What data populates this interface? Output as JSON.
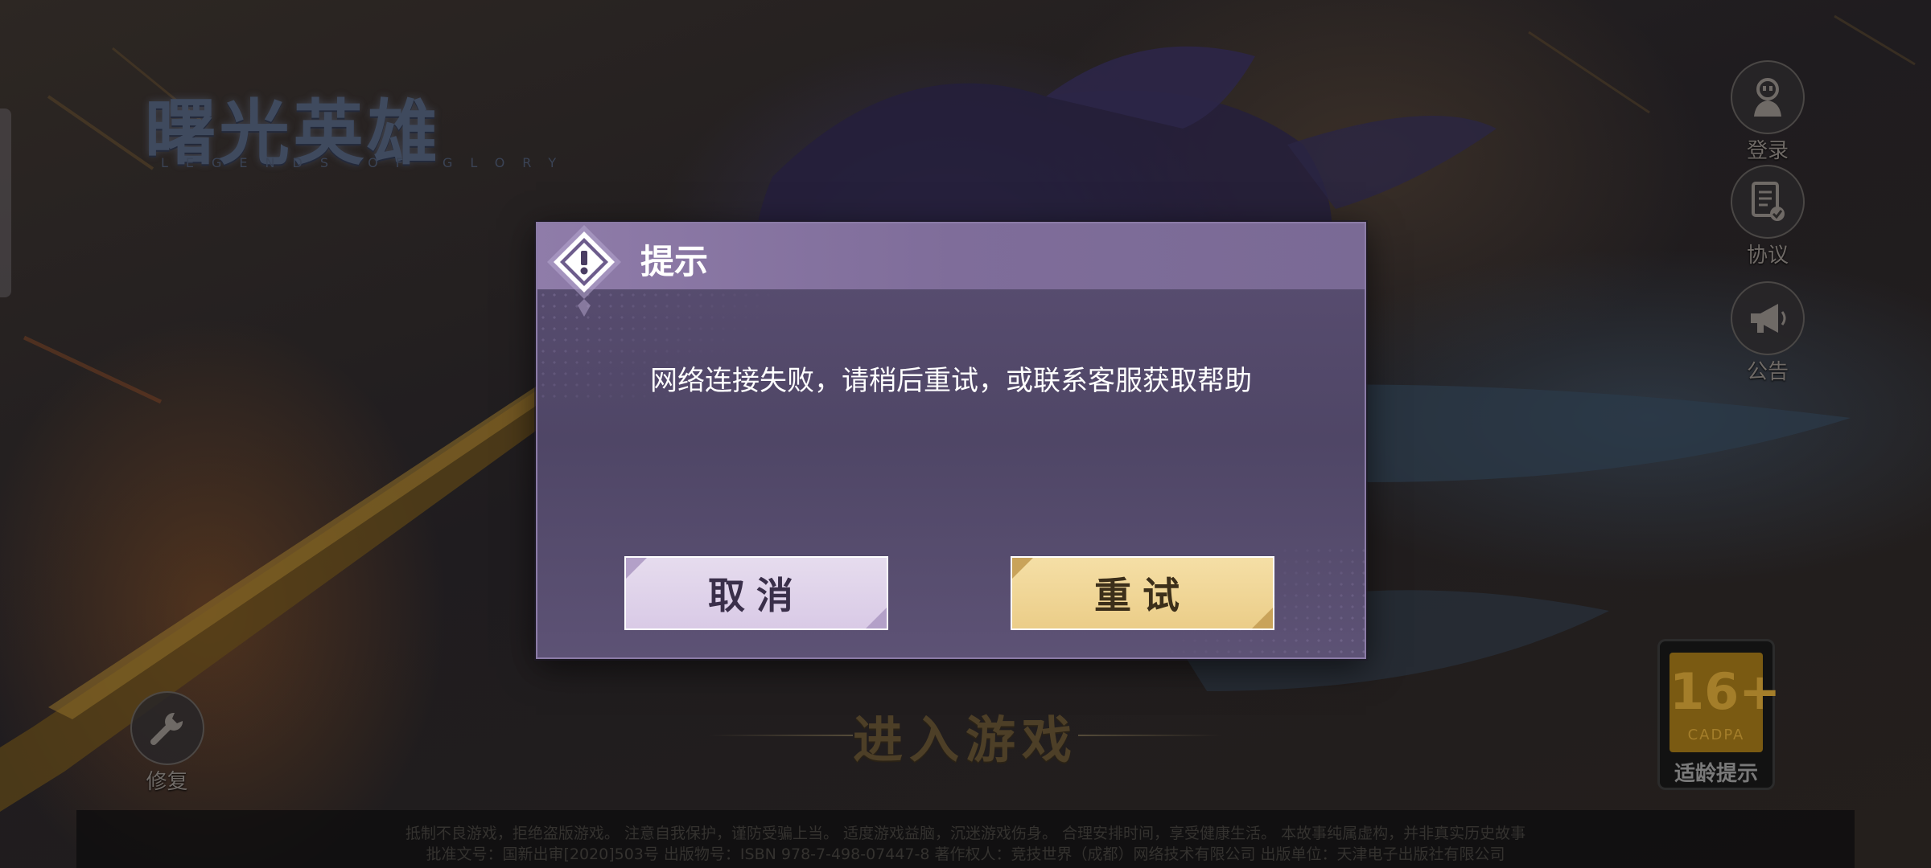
{
  "logo": {
    "title": "曙光英雄",
    "subtitle": "LEGENDS OF GLORY"
  },
  "side_menu": [
    {
      "label": "登录",
      "icon": "character-icon"
    },
    {
      "label": "协议",
      "icon": "document-check-icon"
    },
    {
      "label": "公告",
      "icon": "megaphone-icon"
    }
  ],
  "repair": {
    "label": "修复",
    "icon": "wrench-icon"
  },
  "enter_game": {
    "label": "进入游戏"
  },
  "age_rating": {
    "number": "16+",
    "org": "CADPA",
    "label": "适龄提示"
  },
  "footer": {
    "line1": "抵制不良游戏，拒绝盗版游戏。 注意自我保护，谨防受骗上当。 适度游戏益脑，沉迷游戏伤身。 合理安排时间，享受健康生活。 本故事纯属虚构，并非真实历史故事",
    "line2": "批准文号：国新出审[2020]503号 出版物号：ISBN 978-7-498-07447-8 著作权人：竞技世界（成都）网络技术有限公司 出版单位：天津电子出版社有限公司"
  },
  "dialog": {
    "title": "提示",
    "message": "网络连接失败，请稍后重试，或联系客服获取帮助",
    "cancel_label": "取消",
    "retry_label": "重试"
  },
  "colors": {
    "dialog_header": "#8f7ca9",
    "dialog_body": "#544a6c",
    "cancel_button": "#ddd0e9",
    "retry_button": "#f0d596"
  }
}
